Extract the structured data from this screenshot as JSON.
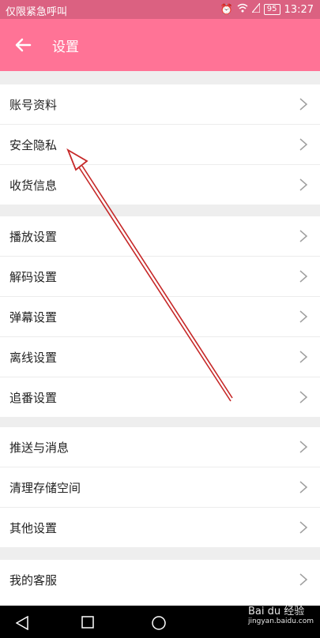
{
  "status_bar": {
    "left_text": "仅限紧急呼叫",
    "battery": "95",
    "time": "13:27"
  },
  "app_bar": {
    "title": "设置"
  },
  "groups": [
    {
      "items": [
        {
          "label": "账号资料"
        },
        {
          "label": "安全隐私"
        },
        {
          "label": "收货信息"
        }
      ]
    },
    {
      "items": [
        {
          "label": "播放设置"
        },
        {
          "label": "解码设置"
        },
        {
          "label": "弹幕设置"
        },
        {
          "label": "离线设置"
        },
        {
          "label": "追番设置"
        }
      ]
    },
    {
      "items": [
        {
          "label": "推送与消息"
        },
        {
          "label": "清理存储空间"
        },
        {
          "label": "其他设置"
        }
      ]
    },
    {
      "items": [
        {
          "label": "我的客服"
        }
      ]
    }
  ],
  "watermark": {
    "brand": "Bai du 经验",
    "url": "jingyan.baidu.com"
  },
  "colors": {
    "status_bar": "#db6181",
    "app_bar": "#ff7396",
    "arrow": "#c62828"
  }
}
